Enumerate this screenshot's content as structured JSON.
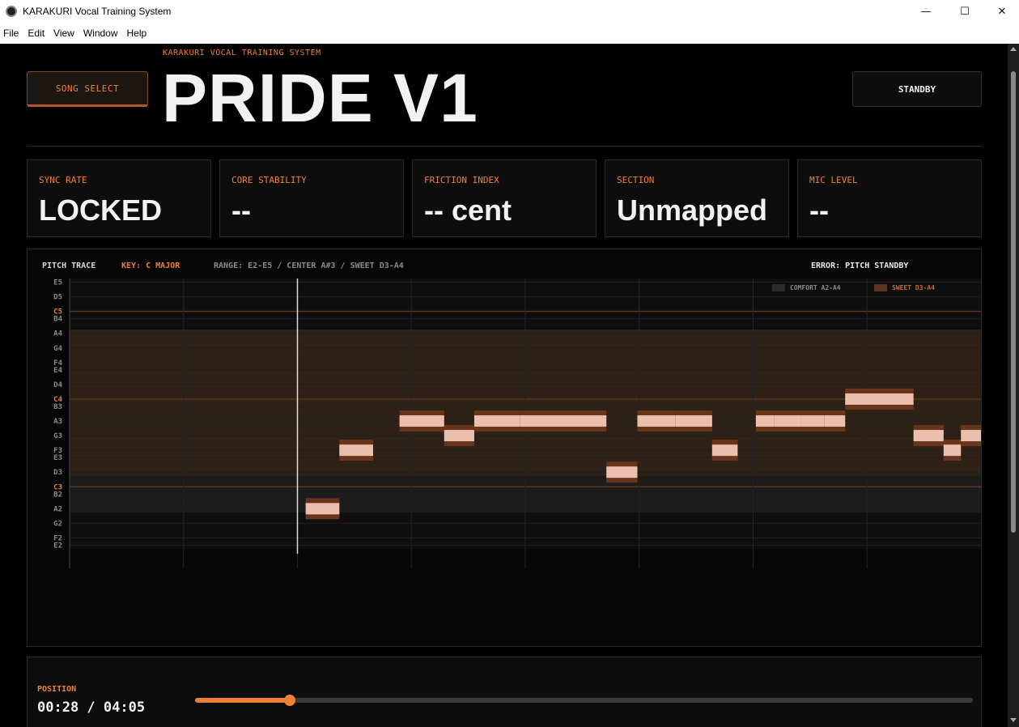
{
  "window": {
    "title": "KARAKURI Vocal Training System"
  },
  "menu": [
    "File",
    "Edit",
    "View",
    "Window",
    "Help"
  ],
  "header": {
    "song_select": "SONG SELECT",
    "system_label": "KARAKURI VOCAL TRAINING SYSTEM",
    "song_title": "PRIDE V1",
    "status_button": "STANDBY"
  },
  "stats": [
    {
      "label": "SYNC RATE",
      "value": "LOCKED"
    },
    {
      "label": "CORE STABILITY",
      "value": "--"
    },
    {
      "label": "FRICTION INDEX",
      "value": "-- cent"
    },
    {
      "label": "SECTION",
      "value": "Unmapped"
    },
    {
      "label": "MIC LEVEL",
      "value": "--"
    }
  ],
  "pitch_trace": {
    "title": "PITCH TRACE",
    "key": "KEY: C MAJOR",
    "range": "RANGE: E2-E5 / CENTER A#3 / SWEET D3-A4",
    "error": "ERROR: PITCH STANDBY",
    "legend": [
      {
        "label": "COMFORT A2-A4",
        "color": "#2a2a2a"
      },
      {
        "label": "SWEET D3-A4",
        "color": "#5a3219"
      }
    ]
  },
  "chart_data": {
    "type": "pitch-trace",
    "y_note_labels": [
      "E5",
      "D5",
      "C5",
      "B4",
      "A4",
      "G4",
      "F4",
      "E4",
      "D4",
      "C4",
      "B3",
      "A3",
      "G3",
      "F3",
      "E3",
      "D3",
      "C3",
      "B2",
      "A2",
      "G2",
      "F2",
      "E2"
    ],
    "highlight_notes": [
      "C5",
      "C4",
      "C3"
    ],
    "comfort_range": [
      "A2",
      "A4"
    ],
    "sweet_range": [
      "D3",
      "A4"
    ],
    "playhead_percent": 25,
    "notes": [
      {
        "pitch": "A2",
        "start": 25.9,
        "end": 29.6
      },
      {
        "pitch": "F3",
        "start": 29.6,
        "end": 33.3
      },
      {
        "pitch": "A3",
        "start": 36.2,
        "end": 41.1
      },
      {
        "pitch": "G3",
        "start": 41.1,
        "end": 44.4
      },
      {
        "pitch": "A3",
        "start": 44.4,
        "end": 49.4
      },
      {
        "pitch": "A3",
        "start": 49.4,
        "end": 52.4
      },
      {
        "pitch": "A3",
        "start": 52.4,
        "end": 58.9
      },
      {
        "pitch": "D3",
        "start": 58.9,
        "end": 62.3
      },
      {
        "pitch": "A3",
        "start": 62.3,
        "end": 66.5
      },
      {
        "pitch": "A3",
        "start": 66.5,
        "end": 70.5
      },
      {
        "pitch": "F3",
        "start": 70.5,
        "end": 73.3
      },
      {
        "pitch": "A3",
        "start": 75.3,
        "end": 77.3
      },
      {
        "pitch": "A3",
        "start": 77.3,
        "end": 80.2
      },
      {
        "pitch": "A3",
        "start": 80.2,
        "end": 82.8
      },
      {
        "pitch": "A3",
        "start": 82.8,
        "end": 85.1
      },
      {
        "pitch": "C4",
        "start": 85.1,
        "end": 92.6
      },
      {
        "pitch": "G3",
        "start": 92.6,
        "end": 95.9
      },
      {
        "pitch": "F3",
        "start": 95.9,
        "end": 97.8
      },
      {
        "pitch": "G3",
        "start": 97.8,
        "end": 100.9
      },
      {
        "pitch": "F3",
        "start": 100.9,
        "end": 106.4
      }
    ]
  },
  "position": {
    "label": "POSITION",
    "time": "00:28 / 04:05",
    "progress": 0.122
  }
}
